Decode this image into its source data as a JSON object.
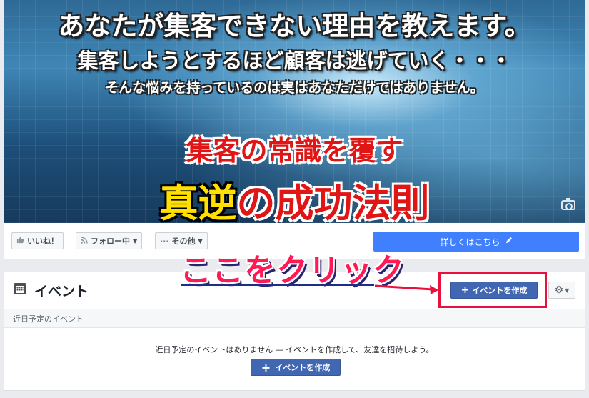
{
  "cover": {
    "line1": "あなたが集客できない理由を教えます。",
    "line2": "集客しようとするほど顧客は逃げていく・・・",
    "line3": "そんな悩みを持っているのは実はあなただけではありません。",
    "line4": "集客の常識を覆す",
    "line5a": "真逆",
    "line5b": "の成功法則",
    "camera_icon": "camera-icon"
  },
  "actionbar": {
    "like_label": "いいね！",
    "follow_label": "フォロー中",
    "more_label": "その他",
    "details_label": "詳しくはこちら",
    "details_color": "#4080ff"
  },
  "events": {
    "title": "イベント",
    "create_label": "イベントを作成",
    "upcoming_header": "近日予定のイベント",
    "empty_message": "近日予定のイベントはありません — イベントを作成して、友達を招待しよう。",
    "create_label_2": "イベントを作成",
    "button_color": "#4267b2"
  },
  "annotation": {
    "text": "ここをクリック",
    "color": "#ff1a56",
    "box_color": "#e8103c"
  }
}
